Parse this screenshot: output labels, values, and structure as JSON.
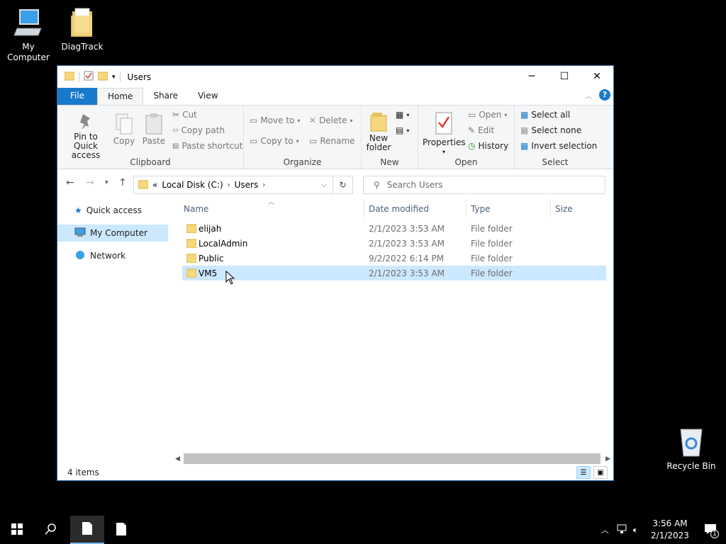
{
  "desktop": {
    "icons": [
      {
        "label": "My Computer"
      },
      {
        "label": "DiagTrack"
      },
      {
        "label": "Recycle Bin"
      }
    ]
  },
  "window": {
    "title": "Users",
    "tabs": {
      "file": "File",
      "home": "Home",
      "share": "Share",
      "view": "View"
    },
    "ribbon": {
      "clipboard": {
        "pin": "Pin to Quick access",
        "copy": "Copy",
        "paste": "Paste",
        "cut": "Cut",
        "copy_path": "Copy path",
        "paste_shortcut": "Paste shortcut",
        "label": "Clipboard"
      },
      "organize": {
        "move_to": "Move to",
        "copy_to": "Copy to",
        "delete": "Delete",
        "rename": "Rename",
        "label": "Organize"
      },
      "new": {
        "new_folder": "New folder",
        "label": "New"
      },
      "open": {
        "properties": "Properties",
        "open": "Open",
        "edit": "Edit",
        "history": "History",
        "label": "Open"
      },
      "select": {
        "select_all": "Select all",
        "select_none": "Select none",
        "invert": "Invert selection",
        "label": "Select"
      }
    },
    "address": {
      "overflow": "«",
      "crumbs": [
        "Local Disk (C:)",
        "Users"
      ],
      "search_placeholder": "Search Users"
    },
    "nav": [
      {
        "label": "Quick access"
      },
      {
        "label": "My Computer"
      },
      {
        "label": "Network"
      }
    ],
    "columns": {
      "name": "Name",
      "date": "Date modified",
      "type": "Type",
      "size": "Size"
    },
    "files": [
      {
        "name": "elijah",
        "date": "2/1/2023 3:53 AM",
        "type": "File folder"
      },
      {
        "name": "LocalAdmin",
        "date": "2/1/2023 3:53 AM",
        "type": "File folder"
      },
      {
        "name": "Public",
        "date": "9/2/2022 6:14 PM",
        "type": "File folder"
      },
      {
        "name": "VM5",
        "date": "2/1/2023 3:53 AM",
        "type": "File folder"
      }
    ],
    "status": "4 items"
  },
  "taskbar": {
    "time": "3:56 AM",
    "date": "2/1/2023",
    "notification_count": "1"
  },
  "colors": {
    "accent": "#1979ca",
    "selection": "#cce8ff"
  }
}
